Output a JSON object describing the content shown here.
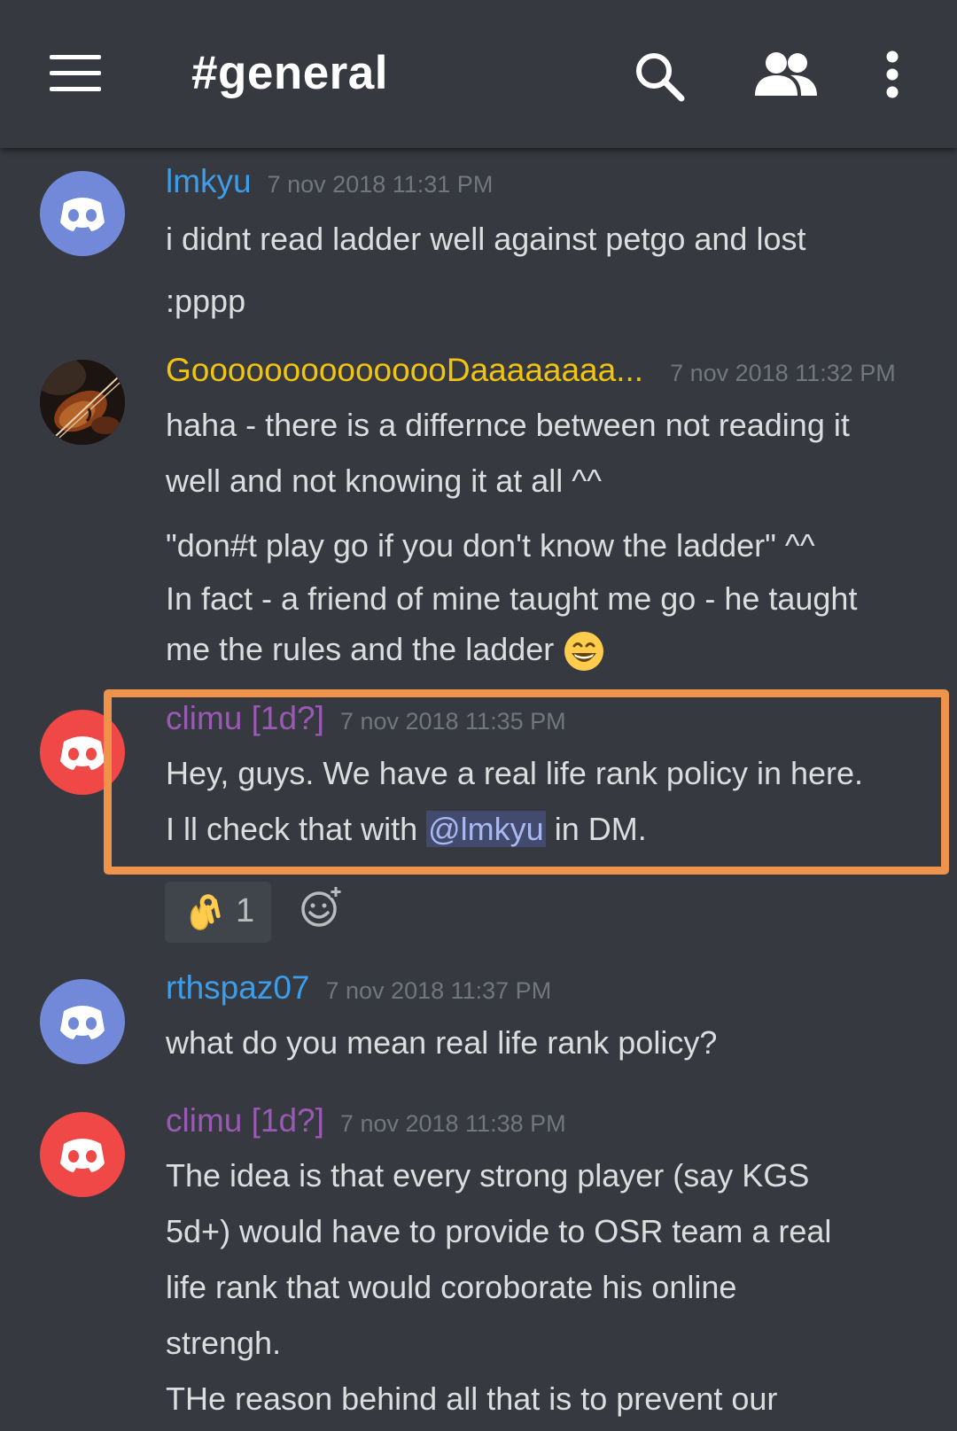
{
  "header": {
    "channel": "#general",
    "menu_icon": "hamburger-menu-icon",
    "search_icon": "search-icon",
    "members_icon": "members-icon",
    "more_icon": "more-vertical-icon"
  },
  "colors": {
    "background": "#36393f",
    "blurple": "#7289da",
    "red": "#f04747",
    "highlight_border": "#f0934a",
    "username_blue": "#3d9de8",
    "username_gold": "#f1c40f",
    "username_purple": "#9b59b6"
  },
  "messages": [
    {
      "author": "lmkyu",
      "timestamp": "7 nov 2018 11:31 PM",
      "lines": [
        "i didnt read ladder well against petgo and lost",
        ":pppp"
      ]
    },
    {
      "author": "GooooooooooooooDaaaaaaaa...",
      "timestamp": "7 nov 2018 11:32 PM",
      "lines": [
        "haha - there is a differnce between not reading it",
        "well and not knowing it at all ^^",
        "\"don#t play go if you don't know the ladder\" ^^",
        "In fact - a friend of mine taught me go - he taught",
        "me the rules and the ladder"
      ],
      "emoji": "grinning-face-emoji"
    },
    {
      "author": "climu [1d?]",
      "timestamp": "7 nov 2018 11:35 PM",
      "line1": "Hey, guys. We have a real life rank policy in here.",
      "line2_prefix": "I ll check that with ",
      "mention": "@lmkyu",
      "line2_suffix": " in DM.",
      "reaction": {
        "emoji": "ok-hand-emoji",
        "count": "1"
      },
      "add_reaction_icon": "add-reaction-icon"
    },
    {
      "author": "rthspaz07",
      "timestamp": "7 nov 2018 11:37 PM",
      "lines": [
        "what do you mean real life rank policy?"
      ]
    },
    {
      "author": "climu [1d?]",
      "timestamp": "7 nov 2018 11:38 PM",
      "lines": [
        "The idea is that every strong player (say KGS",
        "5d+) would have to provide to OSR team a real",
        "life rank that would coroborate his online",
        "strengh.",
        "THe reason behind all that is to prevent our"
      ]
    }
  ]
}
